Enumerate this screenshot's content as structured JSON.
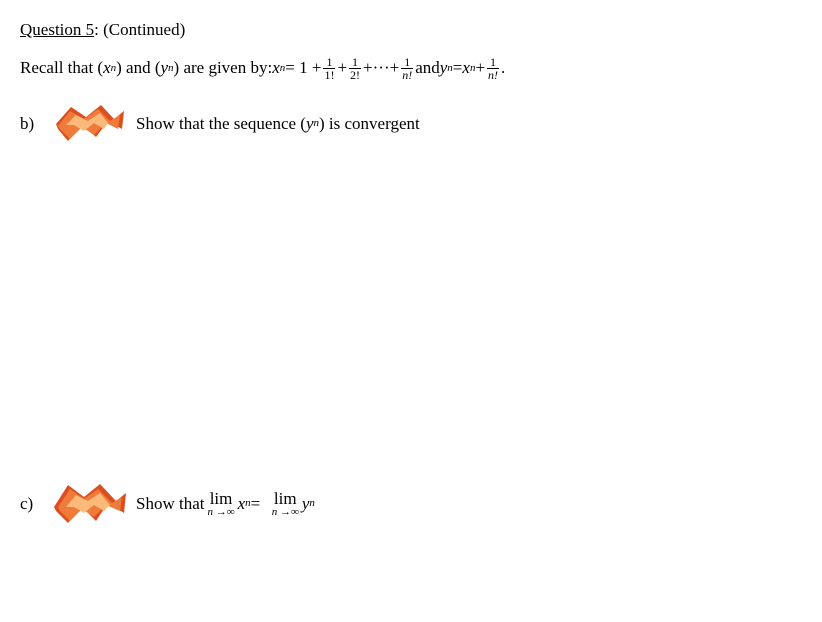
{
  "header": {
    "label": "Question 5",
    "continued": ": (Continued)"
  },
  "recall": {
    "prefix": "Recall that (",
    "xn_x": "x",
    "xn_n": "n",
    "p2": ") and (",
    "yn_y": "y",
    "yn_n": "n",
    "p3": ") are given by: ",
    "eq_x": "x",
    "eq_n": "n",
    "eq_eq": " = 1 + ",
    "f1n": "1",
    "f1d": "1!",
    "plus1": " + ",
    "f2n": "1",
    "f2d": "2!",
    "plus2": " + ",
    "dots": "···",
    "plus3": " + ",
    "f3n": "1",
    "f3d": "n!",
    "and": " and  ",
    "y2": "y",
    "y2n": "n",
    "eq2": " = ",
    "x2": "x",
    "x2n": "n",
    "plus4": " + ",
    "f4n": "1",
    "f4d": "n!",
    "period": "."
  },
  "part_b": {
    "label": "b)",
    "t1": "Show that the sequence (",
    "y": "y",
    "yn": "n",
    "t2": ") is convergent"
  },
  "part_c": {
    "label": "c)",
    "t1": "Show that ",
    "lim": "lim",
    "ninf": "n →∞",
    "x": "x",
    "xn": "n",
    "eq": " = ",
    "y": "y",
    "yn": "n"
  }
}
